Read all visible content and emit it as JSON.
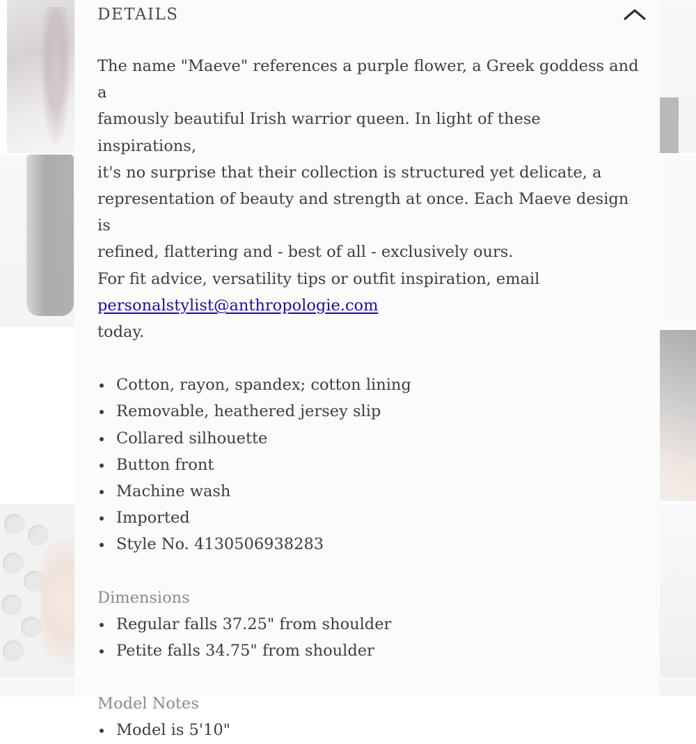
{
  "details": {
    "title": "DETAILS",
    "toggle_icon": "chevron-up-icon",
    "description": {
      "line1": "The name \"Maeve\" references a purple flower, a Greek goddess and a",
      "line2": "famously beautiful Irish warrior queen. In light of these inspirations,",
      "line3": "it's no surprise that their collection is structured yet delicate, a",
      "line4": "representation of beauty and strength at once. Each Maeve design is",
      "line5": "refined, flattering and - best of all - exclusively ours.",
      "line6": "For fit advice, versatility tips or outfit inspiration, email",
      "email": "personalstylist@anthropologie.com",
      "line7": "today."
    },
    "features": [
      "Cotton, rayon, spandex; cotton lining",
      "Removable, heathered jersey slip",
      "Collared silhouette",
      "Button front",
      "Machine wash",
      "Imported",
      "Style No. 4130506938283"
    ],
    "dimensions": {
      "label": "Dimensions",
      "items": [
        "Regular falls 37.25\" from shoulder",
        "Petite falls 34.75\" from shoulder"
      ]
    },
    "model_notes": {
      "label": "Model Notes",
      "items": [
        "Model is 5'10\""
      ]
    }
  },
  "colors": {
    "panel_background": "#fbfbf9",
    "text": "#3d3d3d",
    "muted_label": "#8a8a8a",
    "link": "#1a0dab"
  }
}
